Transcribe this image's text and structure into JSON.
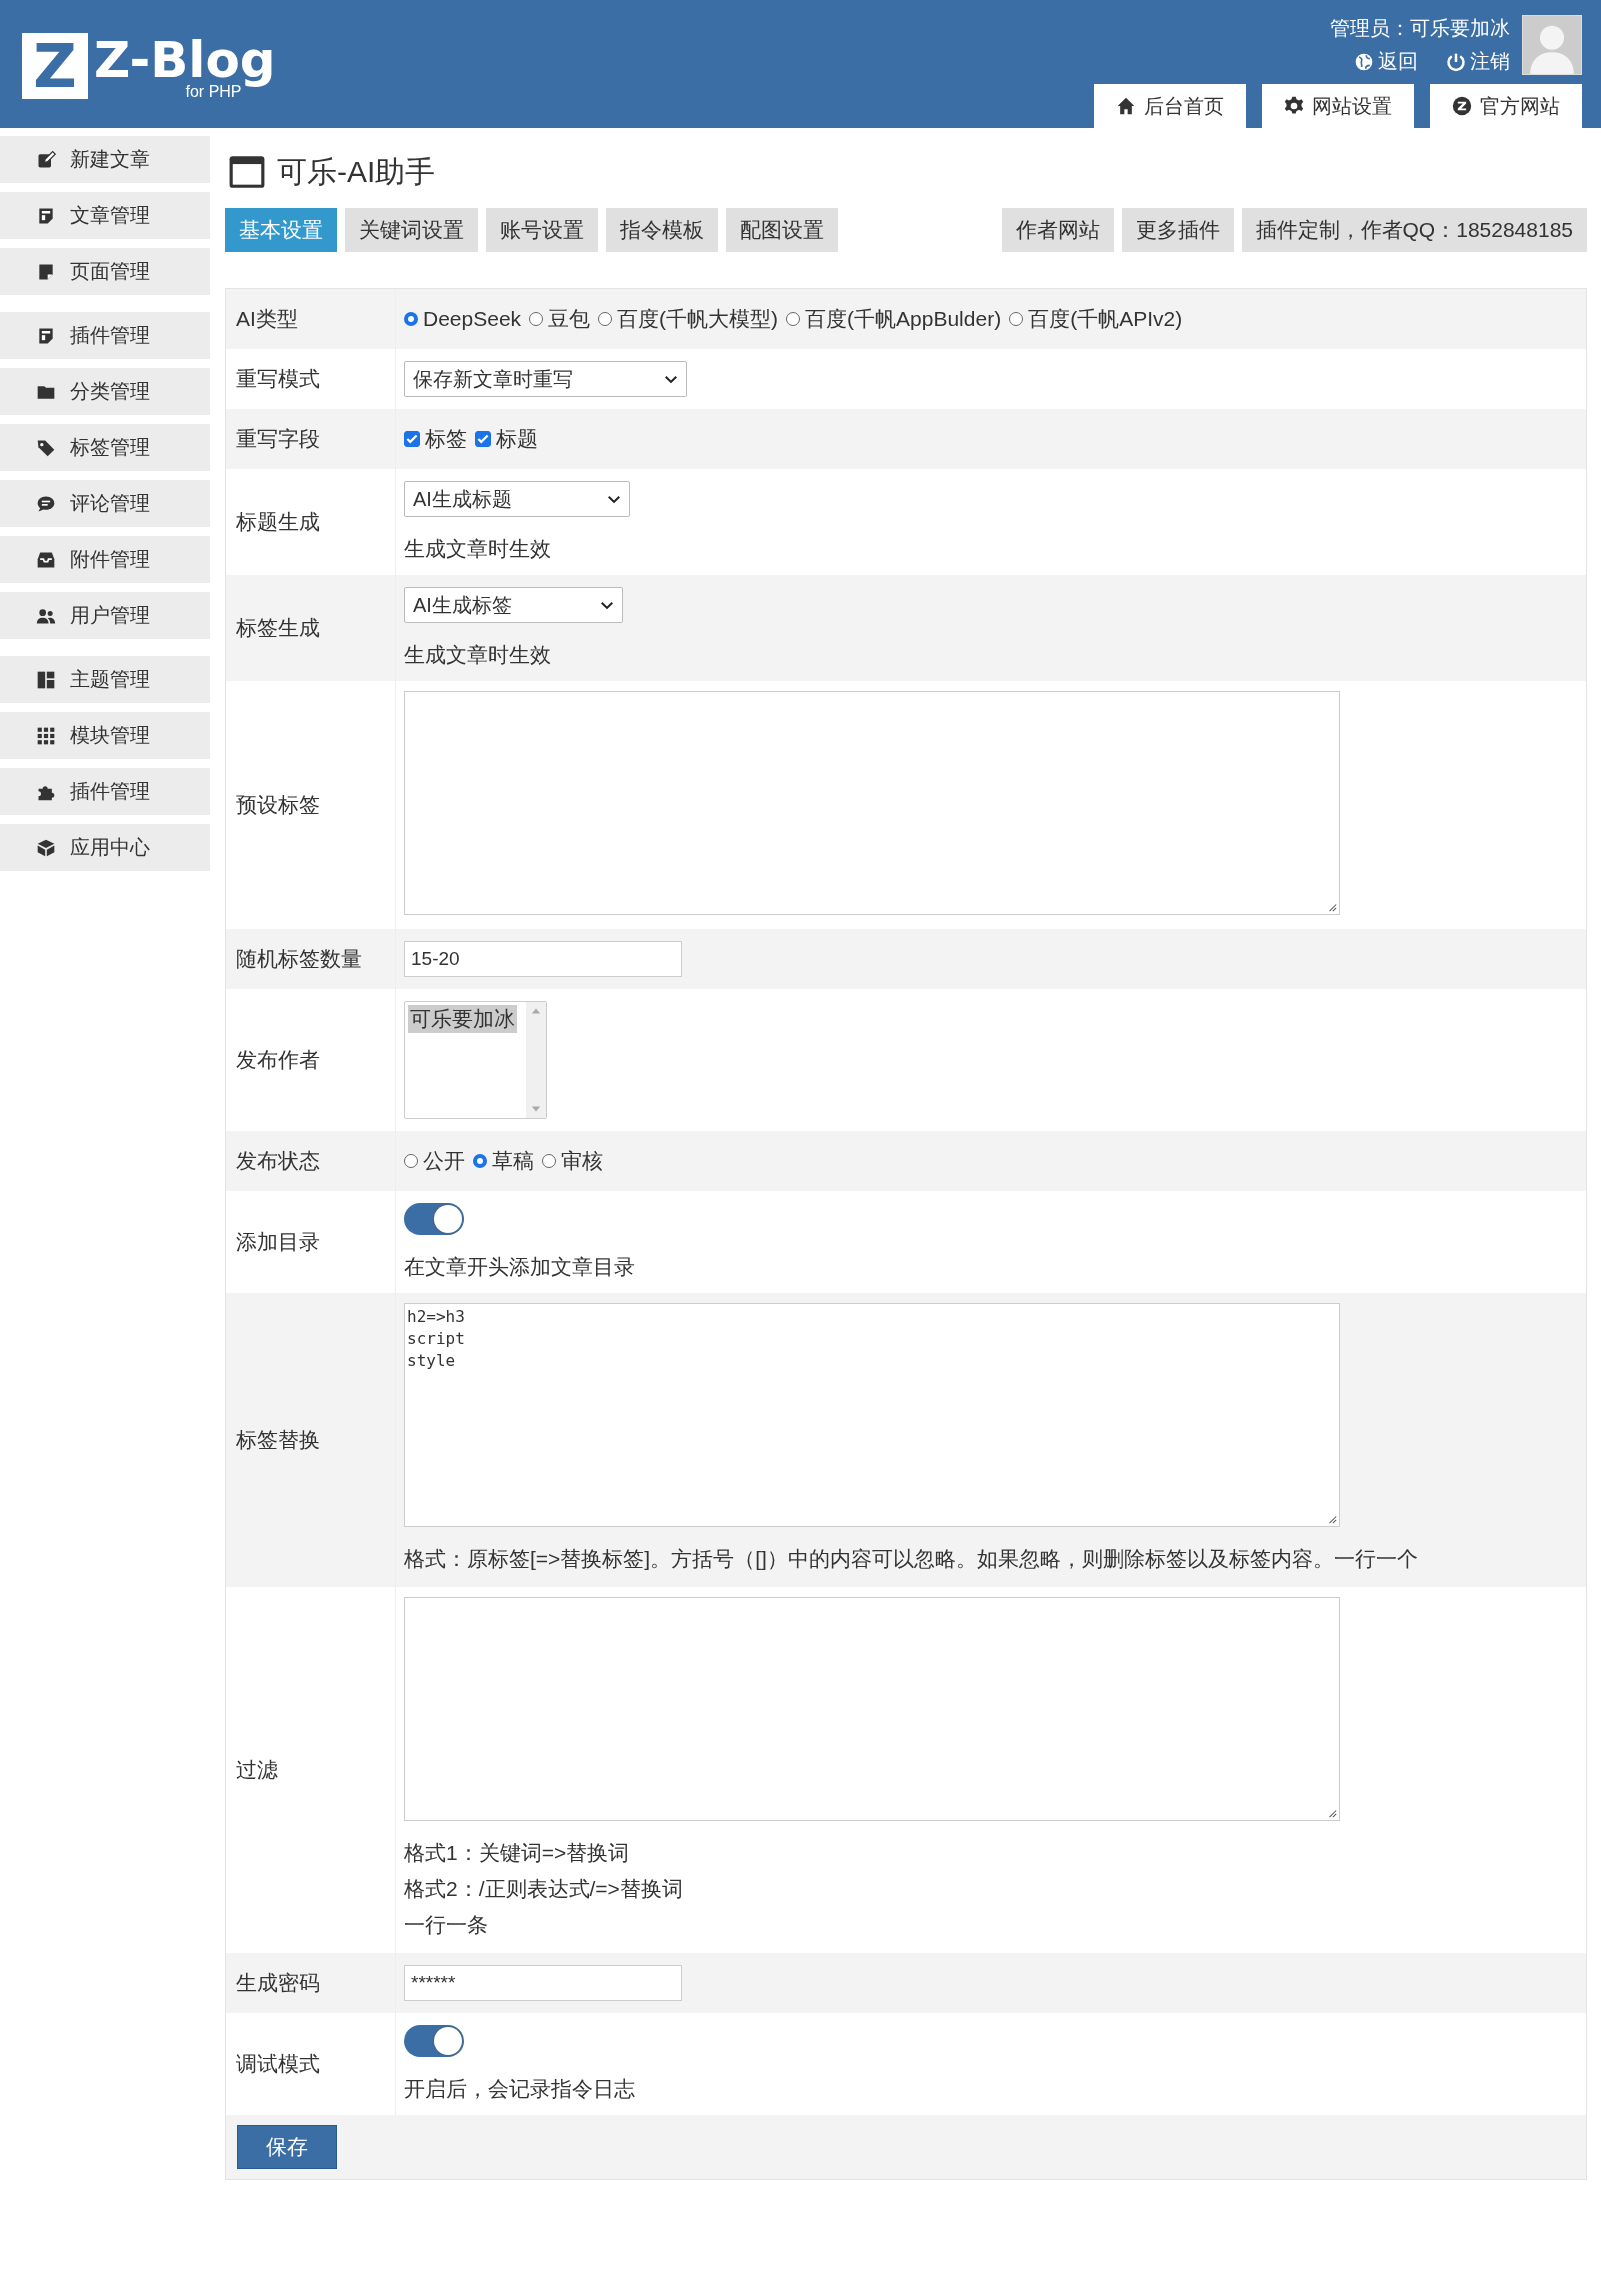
{
  "header": {
    "logo_mark": "Z",
    "logo_text": "Z-Blog",
    "logo_sub": "for PHP",
    "user": "管理员：可乐要加冰",
    "links": [
      {
        "kind": "globe",
        "label": "返回"
      },
      {
        "kind": "power",
        "label": "注销"
      }
    ],
    "nav": [
      {
        "kind": "home",
        "label": "后台首页"
      },
      {
        "kind": "gear",
        "label": "网站设置"
      },
      {
        "kind": "zlogo",
        "label": "官方网站"
      }
    ]
  },
  "sidebar": {
    "groups": [
      {
        "items": [
          {
            "kind": "edit",
            "label": "新建文章"
          },
          {
            "kind": "doc",
            "label": "文章管理"
          },
          {
            "kind": "note",
            "label": "页面管理"
          }
        ]
      },
      {
        "items": [
          {
            "kind": "doc",
            "label": "插件管理"
          },
          {
            "kind": "folder",
            "label": "分类管理"
          },
          {
            "kind": "tag",
            "label": "标签管理"
          },
          {
            "kind": "chat",
            "label": "评论管理"
          },
          {
            "kind": "tray",
            "label": "附件管理"
          },
          {
            "kind": "users",
            "label": "用户管理"
          }
        ]
      },
      {
        "items": [
          {
            "kind": "layout",
            "label": "主题管理"
          },
          {
            "kind": "grid",
            "label": "模块管理"
          },
          {
            "kind": "puzzle",
            "label": "插件管理"
          },
          {
            "kind": "cube",
            "label": "应用中心"
          }
        ]
      }
    ]
  },
  "page_title": "可乐-AI助手",
  "tabs": [
    {
      "label": "基本设置",
      "selected": true
    },
    {
      "label": "关键词设置",
      "selected": false
    },
    {
      "label": "账号设置",
      "selected": false
    },
    {
      "label": "指令模板",
      "selected": false
    },
    {
      "label": "配图设置",
      "selected": false
    }
  ],
  "links": [
    "作者网站",
    "更多插件",
    "插件定制，作者QQ：1852848185"
  ],
  "form": {
    "rows": [
      {
        "label": "AI类型",
        "kind": "radios",
        "options": [
          {
            "label": "DeepSeek",
            "selected": true
          },
          {
            "label": "豆包",
            "selected": false
          },
          {
            "label": "百度(千帆大模型)",
            "selected": false
          },
          {
            "label": "百度(千帆AppBulder)",
            "selected": false
          },
          {
            "label": "百度(千帆APIv2)",
            "selected": false
          }
        ]
      },
      {
        "label": "重写模式",
        "kind": "select",
        "value": "保存新文章时重写"
      },
      {
        "label": "重写字段",
        "kind": "checkboxes",
        "options": [
          {
            "label": "标签",
            "checked": true
          },
          {
            "label": "标题",
            "checked": true
          }
        ]
      },
      {
        "label": "标题生成",
        "kind": "select",
        "value": "AI生成标题",
        "notes": [
          "生成文章时生效"
        ]
      },
      {
        "label": "标签生成",
        "kind": "select",
        "value": "AI生成标签",
        "notes": [
          "生成文章时生效"
        ]
      },
      {
        "label": "预设标签",
        "kind": "textarea"
      },
      {
        "label": "随机标签数量",
        "kind": "input",
        "value": "15-20"
      },
      {
        "label": "发布作者",
        "kind": "listbox",
        "options": [
          {
            "label": "可乐要加冰",
            "selected": true
          }
        ]
      },
      {
        "label": "发布状态",
        "kind": "radios",
        "options": [
          {
            "label": "公开",
            "selected": false
          },
          {
            "label": "草稿",
            "selected": true
          },
          {
            "label": "审核",
            "selected": false
          }
        ]
      },
      {
        "label": "添加目录",
        "kind": "toggle",
        "on": true,
        "notes": [
          "在文章开头添加文章目录"
        ]
      },
      {
        "label": "标签替换",
        "kind": "textarea",
        "value": "h2=>h3\nscript\nstyle",
        "notes": [
          "格式：原标签[=>替换标签]。方括号（[]）中的内容可以忽略。如果忽略，则删除标签以及标签内容。一行一个"
        ]
      },
      {
        "label": "过滤",
        "kind": "textarea",
        "notes": [
          "格式1：关键词=>替换词",
          "格式2：/正则表达式/=>替换词",
          "一行一条"
        ]
      },
      {
        "label": "生成密码",
        "kind": "input",
        "value": "******"
      },
      {
        "label": "调试模式",
        "kind": "toggle",
        "on": true,
        "notes": [
          "开启后，会记录指令日志"
        ]
      }
    ],
    "save_button": "保存"
  }
}
